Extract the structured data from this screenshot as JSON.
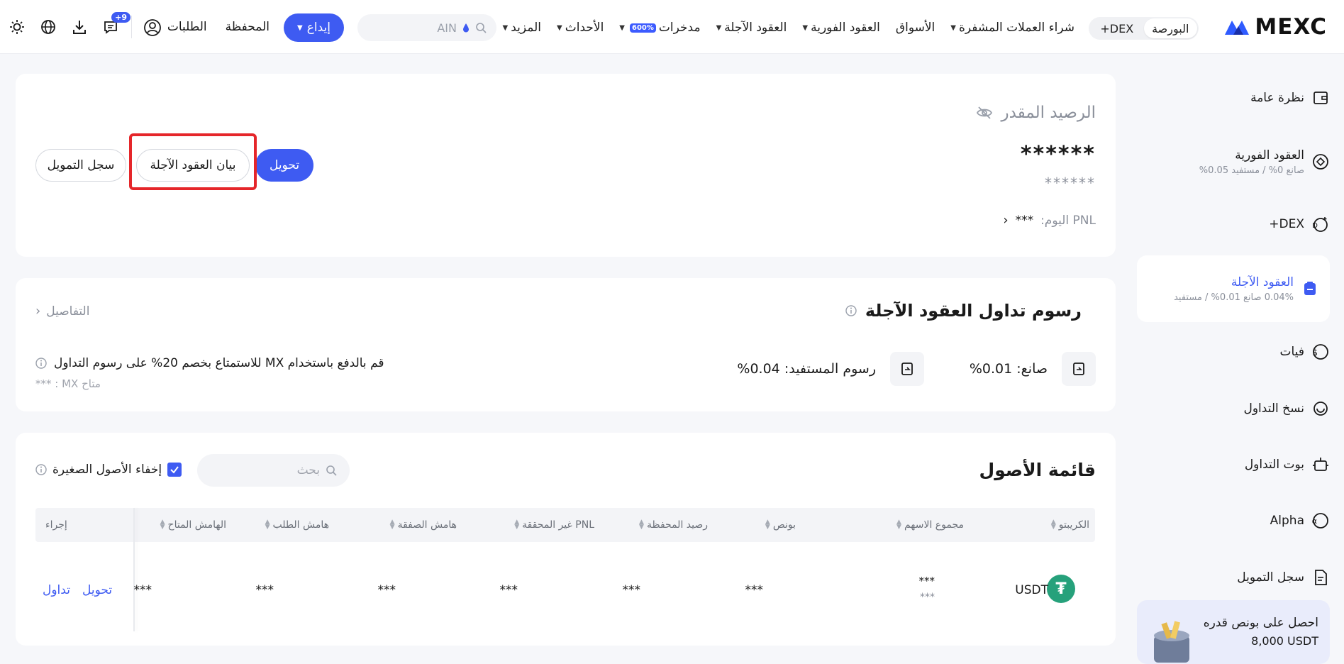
{
  "nav": {
    "logo_text": "MEXC",
    "segment": {
      "exchange": "البورصة",
      "dex": "DEX+"
    },
    "menu": [
      {
        "label": "شراء العملات المشفرة",
        "caret": true,
        "badge": ""
      },
      {
        "label": "الأسواق",
        "caret": false,
        "badge": ""
      },
      {
        "label": "العقود الفورية",
        "caret": true,
        "badge": ""
      },
      {
        "label": "العقود الآجلة",
        "caret": true,
        "badge": ""
      },
      {
        "label": "مدخرات",
        "caret": true,
        "badge": "600%"
      },
      {
        "label": "الأحداث",
        "caret": true,
        "badge": ""
      },
      {
        "label": "المزيد",
        "caret": true,
        "badge": ""
      }
    ],
    "search_value": "AIN",
    "deposit_label": "إيداع",
    "wallet_label": "المحفظة",
    "orders_label": "الطلبات",
    "notif_badge": "+9",
    "accent": "#3e5bf2"
  },
  "sidebar": {
    "items": [
      {
        "label": "نظرة عامة",
        "sub": "",
        "icon": "wallet-icon"
      },
      {
        "label": "العقود الفورية",
        "sub": "صانع 0% / مستفيد 0.05%",
        "icon": "spot-icon"
      },
      {
        "label": "DEX+",
        "sub": "",
        "icon": "dex-icon"
      },
      {
        "label": "العقود الآجلة",
        "sub": "0.04% صانع 0.01% / مستفيد",
        "icon": "futures-icon"
      },
      {
        "label": "فيات",
        "sub": "",
        "icon": "fiat-icon"
      },
      {
        "label": "نسخ التداول",
        "sub": "",
        "icon": "copy-trade-icon"
      },
      {
        "label": "بوت التداول",
        "sub": "",
        "icon": "bot-icon"
      },
      {
        "label": "Alpha",
        "sub": "",
        "icon": "alpha-icon"
      },
      {
        "label": "سجل التمويل",
        "sub": "",
        "icon": "funding-record-icon"
      }
    ],
    "promo": {
      "title": "احصل على بونص قدره",
      "value": "8,000 USDT"
    }
  },
  "balance": {
    "title": "الرصيد المقدر",
    "main": "******",
    "sub": "******",
    "pnl_label": "PNL اليوم:",
    "pnl_value": "***",
    "transfer_label": "تحويل",
    "statement_label": "بيان العقود الآجلة",
    "funding_label": "سجل التمويل"
  },
  "fees": {
    "title": "رسوم تداول العقود الآجلة",
    "details_label": "التفاصيل",
    "maker": "صانع: 0.01%",
    "taker": "رسوم المستفيد: 0.04%",
    "mx_note": "قم بالدفع باستخدام MX للاستمتاع بخصم 20% على رسوم التداول",
    "mx_available": "متاح MX : ***"
  },
  "assets": {
    "title": "قائمة الأصول",
    "search_placeholder": "بحث",
    "hide_small": "إخفاء الأصول الصغيرة",
    "columns": [
      "الكريبتو",
      "مجموع الاسهم",
      "بونص",
      "رصيد المحفظة",
      "PNL غير المحققة",
      "هامش الصفقة",
      "هامش الطلب",
      "الهامش المتاح",
      "إجراء"
    ],
    "row": {
      "coin": "USDT",
      "equity": "***",
      "equity_sub": "***",
      "bonus": "***",
      "wallet": "***",
      "unrealized": "***",
      "position_margin": "***",
      "order_margin": "***",
      "available": "***",
      "action_transfer": "تحويل",
      "action_trade": "تداول"
    }
  }
}
